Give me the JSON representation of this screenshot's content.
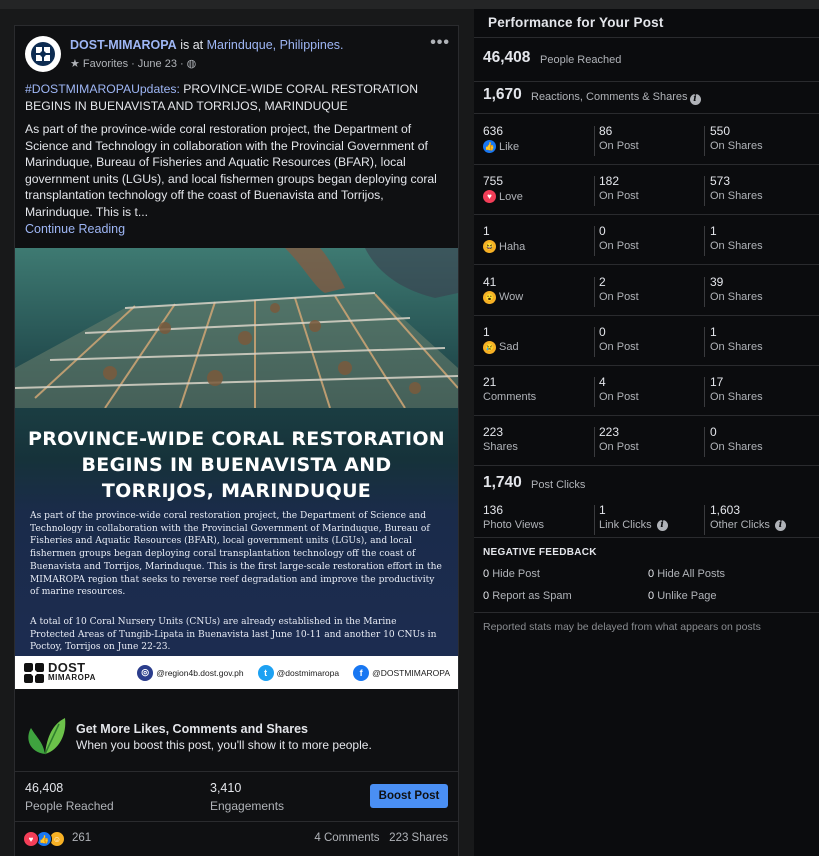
{
  "post": {
    "page_name": "DOST-MIMAROPA",
    "is_at": "is at",
    "location": "Marinduque, Philippines.",
    "audience": "Favorites",
    "date": "June 23",
    "hashtag": "#DOSTMIMAROPAUpdates:",
    "title": "PROVINCE-WIDE CORAL RESTORATION BEGINS IN BUENAVISTA AND TORRIJOS, MARINDUQUE",
    "body": "As part of the province-wide coral restoration project, the Department of Science and Technology in collaboration with the Provincial Government of Marinduque, Bureau of Fisheries and Aquatic Resources (BFAR), local government units (LGUs), and local fishermen groups began deploying coral transplantation technology off the coast of Buenavista and Torrijos, Marinduque. This is t...",
    "continue_label": "Continue Reading",
    "image": {
      "headline_1": "PROVINCE-WIDE CORAL RESTORATION",
      "headline_2": "BEGINS IN BUENAVISTA AND",
      "headline_3": "TORRIJOS, MARINDUQUE",
      "para_1": "As part of the province-wide coral restoration project, the Department of Science and Technology in collaboration with the Provincial Government of Marinduque, Bureau of Fisheries and Aquatic Resources (BFAR), local government units (LGUs), and local fishermen groups began deploying coral transplantation technology off the coast of Buenavista and Torrijos, Marinduque. This is the first large-scale restoration effort in the MIMAROPA region that seeks to reverse reef degradation and improve the productivity of marine resources.",
      "para_2": "A total of 10 Coral Nursery Units (CNUs) are already established in the Marine Protected Areas of Tungib-Lipata in Buenavista last June 10-11 and another 10 CNUs in Poctoy, Torrijos on June 22-23.",
      "logo_word": "DOST",
      "logo_sub": "MIMAROPA",
      "website": "@region4b.dost.gov.ph",
      "twitter": "@dostmimaropa",
      "facebook": "@DOSTMIMAROPA"
    },
    "boost": {
      "title": "Get More Likes, Comments and Shares",
      "subtitle": "When you boost this post, you'll show it to more people."
    },
    "stats": {
      "reached_value": "46,408",
      "reached_label": "People Reached",
      "engagements_value": "3,410",
      "engagements_label": "Engagements",
      "boost_button": "Boost Post"
    },
    "reactions_count": "261",
    "comments": "4 Comments",
    "shares": "223 Shares"
  },
  "performance": {
    "title": "Performance for Your Post",
    "reached_value": "46,408",
    "reached_label": "People Reached",
    "rcs_value": "1,670",
    "rcs_label": "Reactions, Comments & Shares",
    "on_post": "On Post",
    "on_shares": "On Shares",
    "rows": [
      {
        "total": "636",
        "label": "Like",
        "on_post": "86",
        "on_shares": "550"
      },
      {
        "total": "755",
        "label": "Love",
        "on_post": "182",
        "on_shares": "573"
      },
      {
        "total": "1",
        "label": "Haha",
        "on_post": "0",
        "on_shares": "1"
      },
      {
        "total": "41",
        "label": "Wow",
        "on_post": "2",
        "on_shares": "39"
      },
      {
        "total": "1",
        "label": "Sad",
        "on_post": "0",
        "on_shares": "1"
      },
      {
        "total": "21",
        "label": "Comments",
        "on_post": "4",
        "on_shares": "17"
      },
      {
        "total": "223",
        "label": "Shares",
        "on_post": "223",
        "on_shares": "0"
      }
    ],
    "clicks_value": "1,740",
    "clicks_label": "Post Clicks",
    "photo_views_value": "136",
    "photo_views_label": "Photo Views",
    "link_clicks_value": "1",
    "link_clicks_label": "Link Clicks",
    "other_clicks_value": "1,603",
    "other_clicks_label": "Other Clicks",
    "negative": {
      "title": "NEGATIVE FEEDBACK",
      "hide_post_value": "0",
      "hide_post_label": "Hide Post",
      "hide_all_value": "0",
      "hide_all_label": "Hide All Posts",
      "spam_value": "0",
      "spam_label": "Report as Spam",
      "unlike_value": "0",
      "unlike_label": "Unlike Page"
    },
    "disclaimer": "Reported stats may be delayed from what appears on posts"
  },
  "colors": {
    "background": "#18191a",
    "panel": "#0b0c0e",
    "link": "#9eb6f5",
    "boost_button": "#4a8ff4",
    "like": "#1877f2",
    "love": "#f33e58",
    "emoji_yellow": "#f7b125"
  }
}
